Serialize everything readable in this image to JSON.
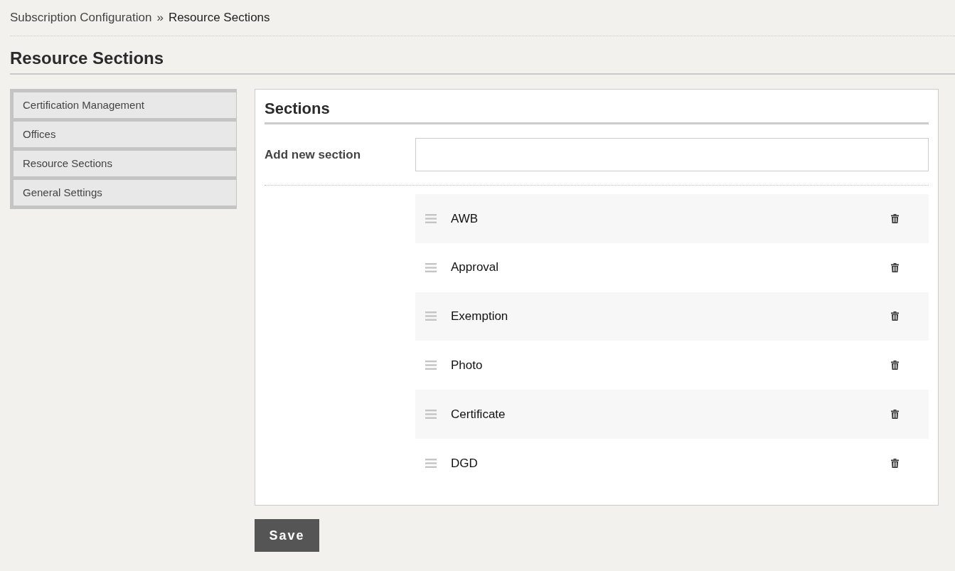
{
  "breadcrumb": [
    {
      "label": "Subscription Configuration",
      "kind": "link"
    },
    {
      "label": "»",
      "kind": "separator"
    },
    {
      "label": "Resource Sections",
      "kind": "current"
    }
  ],
  "page_title": "Resource Sections",
  "sidebar": {
    "items": [
      {
        "label": "Certification Management"
      },
      {
        "label": "Offices"
      },
      {
        "label": "Resource Sections"
      },
      {
        "label": "General Settings"
      }
    ]
  },
  "panel": {
    "title": "Sections",
    "add_field": {
      "label": "Add new section"
    },
    "sections": [
      {
        "name": "AWB"
      },
      {
        "name": "Approval"
      },
      {
        "name": "Exemption"
      },
      {
        "name": "Photo"
      },
      {
        "name": "Certificate"
      },
      {
        "name": "DGD"
      }
    ]
  },
  "save_button": "Save"
}
